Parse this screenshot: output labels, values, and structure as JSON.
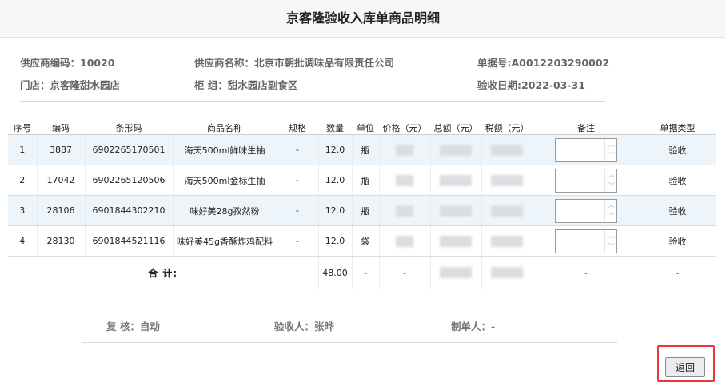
{
  "page": {
    "title": "京客隆验收入库单商品明细"
  },
  "info": {
    "supplier_code": "供应商编码：10020",
    "supplier_name": "供应商名称：北京市朝批调味品有限责任公司",
    "doc_no": "单据号:A0012203290002",
    "store": "门店：京客隆甜水园店",
    "counter": "柜 组：甜水园店副食区",
    "receive_date": "验收日期:2022-03-31"
  },
  "table": {
    "headers": [
      "序号",
      "编码",
      "条形码",
      "商品名称",
      "规格",
      "数量",
      "单位",
      "价格（元）",
      "总额（元）",
      "税额（元）",
      "备注",
      "单据类型"
    ],
    "rows": [
      {
        "no": "1",
        "code": "3887",
        "barcode": "6902265170501",
        "name": "海天500ml鲜味生抽",
        "spec": "-",
        "qty": "12.0",
        "unit": "瓶",
        "type": "验收"
      },
      {
        "no": "2",
        "code": "17042",
        "barcode": "6902265120506",
        "name": "海天500ml金标生抽",
        "spec": "-",
        "qty": "12.0",
        "unit": "瓶",
        "type": "验收"
      },
      {
        "no": "3",
        "code": "28106",
        "barcode": "6901844302210",
        "name": "味好美28g孜然粉",
        "spec": "-",
        "qty": "12.0",
        "unit": "瓶",
        "type": "验收"
      },
      {
        "no": "4",
        "code": "28130",
        "barcode": "6901844521116",
        "name": "味好美45g香酥炸鸡配料",
        "spec": "-",
        "qty": "12.0",
        "unit": "袋",
        "type": "验收"
      }
    ],
    "total": {
      "label": "合 计:",
      "qty": "48.00",
      "unit": "-",
      "price": "-",
      "remark": "-",
      "type": "-"
    }
  },
  "signatures": {
    "reviewer": "复 核：自动",
    "receiver": "验收人：张晔",
    "creator": "制单人：-"
  },
  "buttons": {
    "back": "返回"
  },
  "colors": {
    "highlight": "#e53935",
    "row_alt": "#eef5fa"
  }
}
